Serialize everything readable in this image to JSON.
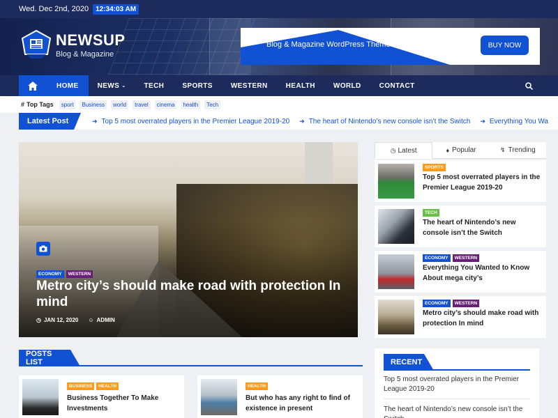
{
  "topbar": {
    "date": "Wed. Dec 2nd, 2020",
    "time": "12:34:03 AM"
  },
  "logo": {
    "title": "NEWSUP",
    "subtitle": "Blog & Magazine"
  },
  "ad": {
    "text": "Blog & Magazine WordPress Theme",
    "button": "BUY NOW"
  },
  "nav": {
    "items": [
      {
        "label": "HOME",
        "active": true
      },
      {
        "label": "NEWS",
        "dropdown": true
      },
      {
        "label": "TECH"
      },
      {
        "label": "SPORTS"
      },
      {
        "label": "WESTERN"
      },
      {
        "label": "HEALTH"
      },
      {
        "label": "WORLD"
      },
      {
        "label": "CONTACT"
      }
    ]
  },
  "tags": {
    "label": "Top Tags",
    "items": [
      "sport",
      "Business",
      "world",
      "travel",
      "cinema",
      "health",
      "Tech"
    ]
  },
  "ticker": {
    "label": "Latest Post",
    "items": [
      "Top 5 most overrated players in the Premier League 2019-20",
      "The heart of Nintendo’s new console isn’t the Switch",
      "Everything You Wa"
    ]
  },
  "featured": {
    "categories": [
      "ECONOMY",
      "WESTERN"
    ],
    "title": "Metro city’s should make road with protection In mind",
    "date": "JAN 12, 2020",
    "author": "ADMIN"
  },
  "sidebar_tabs": {
    "tabs": [
      "Latest",
      "Popular",
      "Trending"
    ],
    "active": "Latest"
  },
  "sidebar_posts": [
    {
      "categories": [
        "SPORTS"
      ],
      "title": "Top 5 most overrated players in the Premier League 2019-20"
    },
    {
      "categories": [
        "TECH"
      ],
      "title": "The heart of Nintendo’s new console isn’t the Switch"
    },
    {
      "categories": [
        "ECONOMY",
        "WESTERN"
      ],
      "title": "Everything You Wanted to Know About mega city’s"
    },
    {
      "categories": [
        "ECONOMY",
        "WESTERN"
      ],
      "title": "Metro city’s should make road with protection In mind"
    }
  ],
  "posts_list": {
    "heading": "POSTS LIST",
    "items": [
      {
        "categories": [
          "BUSINESS",
          "HEALTH"
        ],
        "title": "Business Together To Make Investments"
      },
      {
        "categories": [
          "HEALTH"
        ],
        "title": "But who has any right to find of existence in present"
      }
    ]
  },
  "recent": {
    "heading": "RECENT",
    "items": [
      "Top 5 most overrated players in the Premier League 2019-20",
      "The heart of Nintendo’s new console isn’t the Switch"
    ]
  },
  "colors": {
    "navy": "#1d2a5c",
    "accent": "#1151d3",
    "orange": "#ff9a1a",
    "purple": "#6a1d78",
    "green": "#6bbf44"
  },
  "icons": [
    "home-icon",
    "search-icon",
    "hashtag-icon",
    "camera-icon",
    "clock-icon",
    "user-icon",
    "fire-icon",
    "bolt-icon",
    "arrow-icon"
  ]
}
